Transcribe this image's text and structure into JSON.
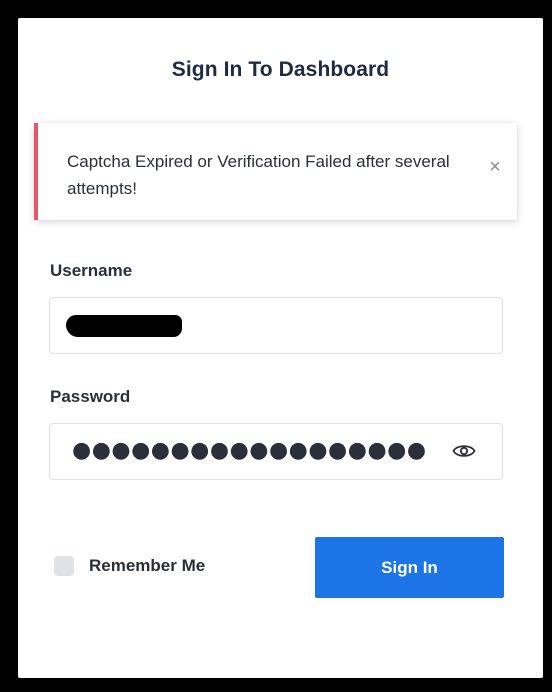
{
  "header": {
    "title": "Sign In To Dashboard"
  },
  "alert": {
    "message": "Captcha Expired or Verification Failed after several attempts!",
    "close_glyph": "×",
    "accent_color": "#e5566b"
  },
  "form": {
    "username": {
      "label": "Username",
      "value_redacted": true
    },
    "password": {
      "label": "Password",
      "masked_value": "●●●●●●●●●●●●●●●●●●",
      "toggle_icon": "eye-icon"
    },
    "remember": {
      "label": "Remember Me",
      "checked": false
    },
    "submit": {
      "label": "Sign In",
      "color": "#1d74e6"
    }
  }
}
